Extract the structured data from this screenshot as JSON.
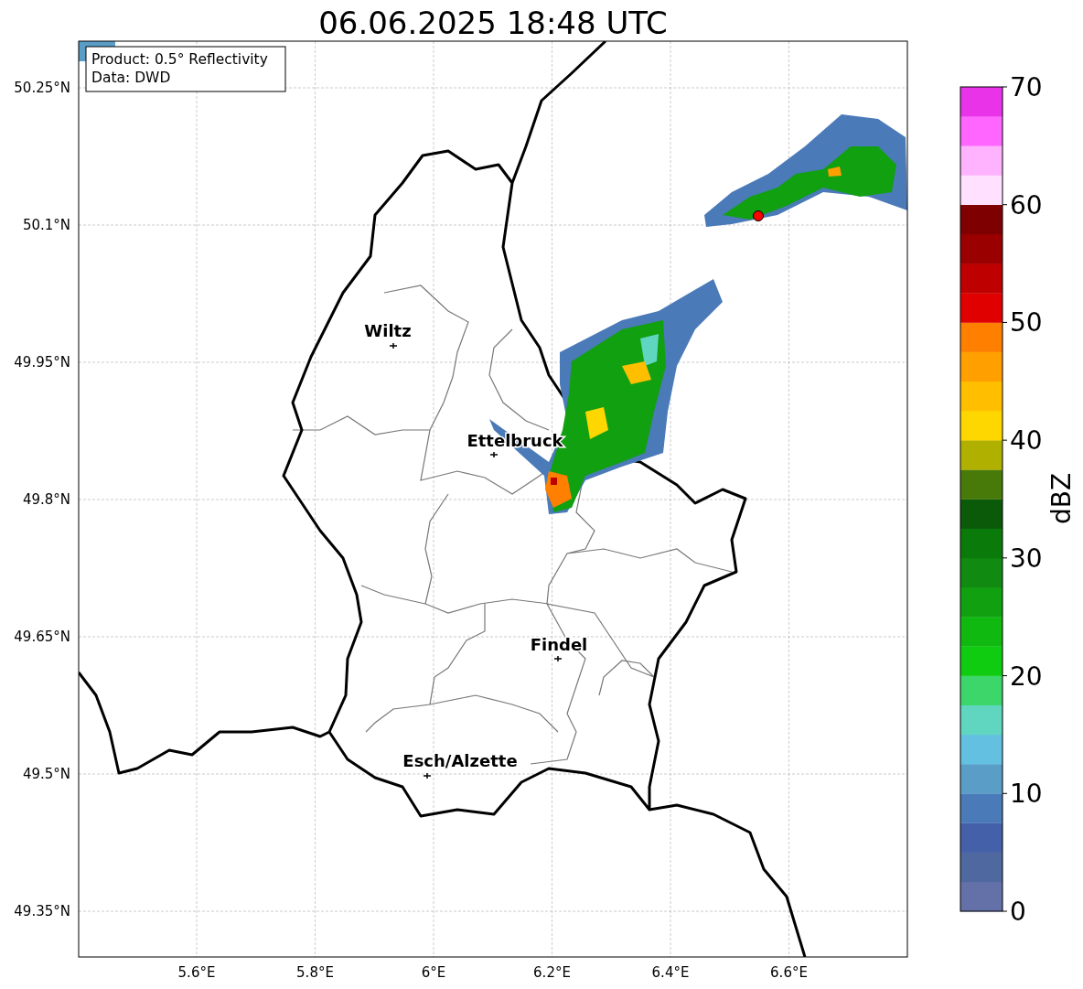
{
  "title": "06.06.2025 18:48 UTC",
  "info_box": [
    "Product: 0.5° Reflectivity",
    "Data: DWD"
  ],
  "lat_ticks": [
    "50.25°N",
    "50.1°N",
    "49.95°N",
    "49.8°N",
    "49.65°N",
    "49.5°N",
    "49.35°N"
  ],
  "lon_ticks": [
    "5.6°E",
    "5.8°E",
    "6°E",
    "6.2°E",
    "6.4°E",
    "6.6°E"
  ],
  "cities": [
    {
      "name": "Wiltz"
    },
    {
      "name": "Ettelbruck"
    },
    {
      "name": "Findel"
    },
    {
      "name": "Esch/Alzette"
    }
  ],
  "colorbar": {
    "label": "dBZ",
    "ticks": [
      "70",
      "60",
      "50",
      "40",
      "30",
      "20",
      "10",
      "0"
    ],
    "segments": [
      {
        "color": "#6470a8"
      },
      {
        "color": "#5068a0"
      },
      {
        "color": "#4460a8"
      },
      {
        "color": "#4a7ab8"
      },
      {
        "color": "#5a9ec8"
      },
      {
        "color": "#64c0e0"
      },
      {
        "color": "#60d6c0"
      },
      {
        "color": "#3cd66a"
      },
      {
        "color": "#10cc10"
      },
      {
        "color": "#10b910"
      },
      {
        "color": "#10a010"
      },
      {
        "color": "#108a10"
      },
      {
        "color": "#0a7a0a"
      },
      {
        "color": "#0a5a0a"
      },
      {
        "color": "#487a0a"
      },
      {
        "color": "#b0b000"
      },
      {
        "color": "#ffd700"
      },
      {
        "color": "#ffbf00"
      },
      {
        "color": "#ff9f00"
      },
      {
        "color": "#ff7f00"
      },
      {
        "color": "#e00000"
      },
      {
        "color": "#be0000"
      },
      {
        "color": "#9b0000"
      },
      {
        "color": "#7f0000"
      },
      {
        "color": "#ffe0ff"
      },
      {
        "color": "#ffb3ff"
      },
      {
        "color": "#ff66ff"
      },
      {
        "color": "#e933e9"
      }
    ]
  }
}
